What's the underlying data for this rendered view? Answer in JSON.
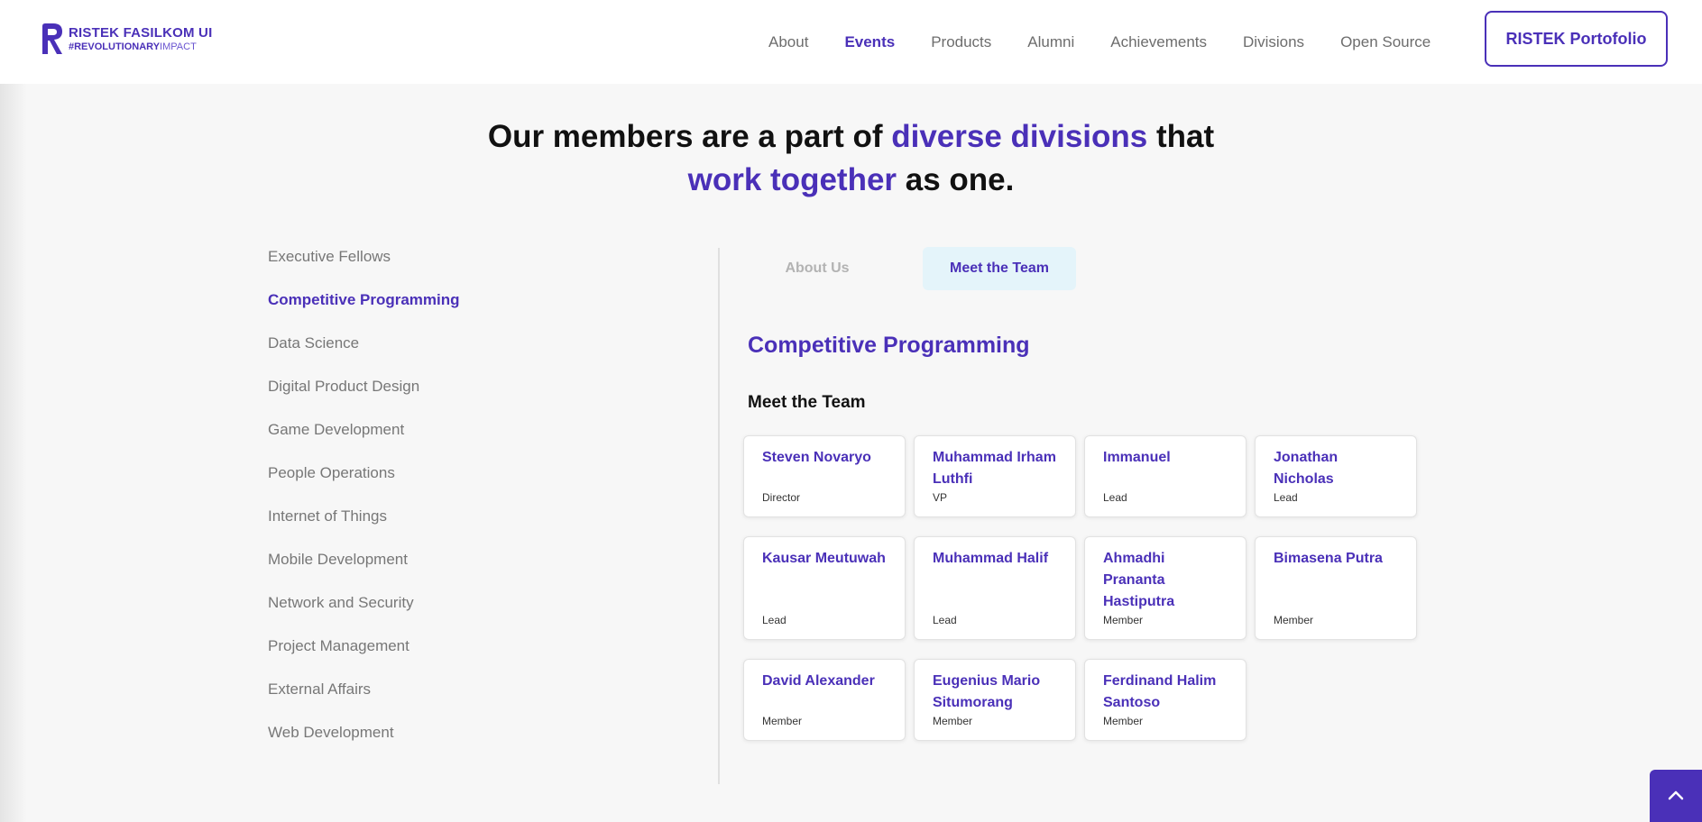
{
  "brand": {
    "title": "RISTEK FASILKOM UI",
    "tag_bold": "#REVOLUTIONARY",
    "tag_light": "IMPACT",
    "accent_color": "#4a30b8"
  },
  "nav": {
    "items": [
      {
        "label": "About"
      },
      {
        "label": "Events"
      },
      {
        "label": "Products"
      },
      {
        "label": "Alumni"
      },
      {
        "label": "Achievements"
      },
      {
        "label": "Divisions"
      },
      {
        "label": "Open Source"
      }
    ],
    "active": "Events",
    "cta_label": "RISTEK Portofolio"
  },
  "headline": {
    "part1": "Our members are a part of ",
    "accent1": "diverse divisions",
    "part2": " that",
    "accent2": "work together",
    "part3": " as one."
  },
  "divisions": {
    "items": [
      "Executive Fellows",
      "Competitive Programming",
      "Data Science",
      "Digital Product Design",
      "Game Development",
      "People Operations",
      "Internet of Things",
      "Mobile Development",
      "Network and Security",
      "Project Management",
      "External Affairs",
      "Web Development"
    ],
    "active": "Competitive Programming"
  },
  "tabs": {
    "about_label": "About Us",
    "team_label": "Meet the Team",
    "active": "Meet the Team"
  },
  "section": {
    "title": "Competitive Programming",
    "subtitle": "Meet the Team"
  },
  "team": [
    {
      "name": "Steven Novaryo",
      "role": "Director"
    },
    {
      "name": "Muhammad Irham Luthfi",
      "role": "VP"
    },
    {
      "name": "Immanuel",
      "role": "Lead"
    },
    {
      "name": "Jonathan Nicholas",
      "role": "Lead"
    },
    {
      "name": "Kausar Meutuwah",
      "role": "Lead"
    },
    {
      "name": "Muhammad Halif",
      "role": "Lead"
    },
    {
      "name": "Ahmadhi Prananta Hastiputra",
      "role": "Member"
    },
    {
      "name": "Bimasena Putra",
      "role": "Member"
    },
    {
      "name": "David Alexander",
      "role": "Member"
    },
    {
      "name": "Eugenius Mario Situmorang",
      "role": "Member"
    },
    {
      "name": "Ferdinand Halim Santoso",
      "role": "Member"
    }
  ],
  "icons": {
    "scroll_top": "chevron-up-icon",
    "logo": "ristek-r-logo-icon"
  }
}
